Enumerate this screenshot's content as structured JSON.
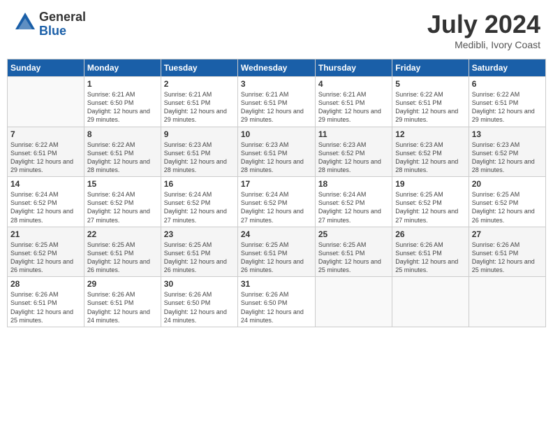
{
  "header": {
    "logo_line1": "General",
    "logo_line2": "Blue",
    "title": "July 2024",
    "location": "Medibli, Ivory Coast"
  },
  "days_of_week": [
    "Sunday",
    "Monday",
    "Tuesday",
    "Wednesday",
    "Thursday",
    "Friday",
    "Saturday"
  ],
  "weeks": [
    [
      {
        "day": "",
        "sunrise": "",
        "sunset": "",
        "daylight": "",
        "empty": true
      },
      {
        "day": "1",
        "sunrise": "Sunrise: 6:21 AM",
        "sunset": "Sunset: 6:50 PM",
        "daylight": "Daylight: 12 hours and 29 minutes."
      },
      {
        "day": "2",
        "sunrise": "Sunrise: 6:21 AM",
        "sunset": "Sunset: 6:51 PM",
        "daylight": "Daylight: 12 hours and 29 minutes."
      },
      {
        "day": "3",
        "sunrise": "Sunrise: 6:21 AM",
        "sunset": "Sunset: 6:51 PM",
        "daylight": "Daylight: 12 hours and 29 minutes."
      },
      {
        "day": "4",
        "sunrise": "Sunrise: 6:21 AM",
        "sunset": "Sunset: 6:51 PM",
        "daylight": "Daylight: 12 hours and 29 minutes."
      },
      {
        "day": "5",
        "sunrise": "Sunrise: 6:22 AM",
        "sunset": "Sunset: 6:51 PM",
        "daylight": "Daylight: 12 hours and 29 minutes."
      },
      {
        "day": "6",
        "sunrise": "Sunrise: 6:22 AM",
        "sunset": "Sunset: 6:51 PM",
        "daylight": "Daylight: 12 hours and 29 minutes."
      }
    ],
    [
      {
        "day": "7",
        "sunrise": "Sunrise: 6:22 AM",
        "sunset": "Sunset: 6:51 PM",
        "daylight": "Daylight: 12 hours and 29 minutes."
      },
      {
        "day": "8",
        "sunrise": "Sunrise: 6:22 AM",
        "sunset": "Sunset: 6:51 PM",
        "daylight": "Daylight: 12 hours and 28 minutes."
      },
      {
        "day": "9",
        "sunrise": "Sunrise: 6:23 AM",
        "sunset": "Sunset: 6:51 PM",
        "daylight": "Daylight: 12 hours and 28 minutes."
      },
      {
        "day": "10",
        "sunrise": "Sunrise: 6:23 AM",
        "sunset": "Sunset: 6:51 PM",
        "daylight": "Daylight: 12 hours and 28 minutes."
      },
      {
        "day": "11",
        "sunrise": "Sunrise: 6:23 AM",
        "sunset": "Sunset: 6:52 PM",
        "daylight": "Daylight: 12 hours and 28 minutes."
      },
      {
        "day": "12",
        "sunrise": "Sunrise: 6:23 AM",
        "sunset": "Sunset: 6:52 PM",
        "daylight": "Daylight: 12 hours and 28 minutes."
      },
      {
        "day": "13",
        "sunrise": "Sunrise: 6:23 AM",
        "sunset": "Sunset: 6:52 PM",
        "daylight": "Daylight: 12 hours and 28 minutes."
      }
    ],
    [
      {
        "day": "14",
        "sunrise": "Sunrise: 6:24 AM",
        "sunset": "Sunset: 6:52 PM",
        "daylight": "Daylight: 12 hours and 28 minutes."
      },
      {
        "day": "15",
        "sunrise": "Sunrise: 6:24 AM",
        "sunset": "Sunset: 6:52 PM",
        "daylight": "Daylight: 12 hours and 27 minutes."
      },
      {
        "day": "16",
        "sunrise": "Sunrise: 6:24 AM",
        "sunset": "Sunset: 6:52 PM",
        "daylight": "Daylight: 12 hours and 27 minutes."
      },
      {
        "day": "17",
        "sunrise": "Sunrise: 6:24 AM",
        "sunset": "Sunset: 6:52 PM",
        "daylight": "Daylight: 12 hours and 27 minutes."
      },
      {
        "day": "18",
        "sunrise": "Sunrise: 6:24 AM",
        "sunset": "Sunset: 6:52 PM",
        "daylight": "Daylight: 12 hours and 27 minutes."
      },
      {
        "day": "19",
        "sunrise": "Sunrise: 6:25 AM",
        "sunset": "Sunset: 6:52 PM",
        "daylight": "Daylight: 12 hours and 27 minutes."
      },
      {
        "day": "20",
        "sunrise": "Sunrise: 6:25 AM",
        "sunset": "Sunset: 6:52 PM",
        "daylight": "Daylight: 12 hours and 26 minutes."
      }
    ],
    [
      {
        "day": "21",
        "sunrise": "Sunrise: 6:25 AM",
        "sunset": "Sunset: 6:52 PM",
        "daylight": "Daylight: 12 hours and 26 minutes."
      },
      {
        "day": "22",
        "sunrise": "Sunrise: 6:25 AM",
        "sunset": "Sunset: 6:51 PM",
        "daylight": "Daylight: 12 hours and 26 minutes."
      },
      {
        "day": "23",
        "sunrise": "Sunrise: 6:25 AM",
        "sunset": "Sunset: 6:51 PM",
        "daylight": "Daylight: 12 hours and 26 minutes."
      },
      {
        "day": "24",
        "sunrise": "Sunrise: 6:25 AM",
        "sunset": "Sunset: 6:51 PM",
        "daylight": "Daylight: 12 hours and 26 minutes."
      },
      {
        "day": "25",
        "sunrise": "Sunrise: 6:25 AM",
        "sunset": "Sunset: 6:51 PM",
        "daylight": "Daylight: 12 hours and 25 minutes."
      },
      {
        "day": "26",
        "sunrise": "Sunrise: 6:26 AM",
        "sunset": "Sunset: 6:51 PM",
        "daylight": "Daylight: 12 hours and 25 minutes."
      },
      {
        "day": "27",
        "sunrise": "Sunrise: 6:26 AM",
        "sunset": "Sunset: 6:51 PM",
        "daylight": "Daylight: 12 hours and 25 minutes."
      }
    ],
    [
      {
        "day": "28",
        "sunrise": "Sunrise: 6:26 AM",
        "sunset": "Sunset: 6:51 PM",
        "daylight": "Daylight: 12 hours and 25 minutes."
      },
      {
        "day": "29",
        "sunrise": "Sunrise: 6:26 AM",
        "sunset": "Sunset: 6:51 PM",
        "daylight": "Daylight: 12 hours and 24 minutes."
      },
      {
        "day": "30",
        "sunrise": "Sunrise: 6:26 AM",
        "sunset": "Sunset: 6:50 PM",
        "daylight": "Daylight: 12 hours and 24 minutes."
      },
      {
        "day": "31",
        "sunrise": "Sunrise: 6:26 AM",
        "sunset": "Sunset: 6:50 PM",
        "daylight": "Daylight: 12 hours and 24 minutes."
      },
      {
        "day": "",
        "sunrise": "",
        "sunset": "",
        "daylight": "",
        "empty": true
      },
      {
        "day": "",
        "sunrise": "",
        "sunset": "",
        "daylight": "",
        "empty": true
      },
      {
        "day": "",
        "sunrise": "",
        "sunset": "",
        "daylight": "",
        "empty": true
      }
    ]
  ]
}
